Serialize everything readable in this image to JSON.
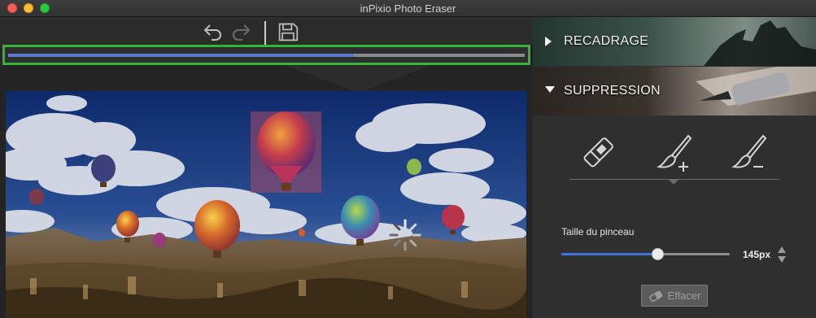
{
  "window": {
    "title": "inPixio Photo Eraser"
  },
  "toolbar": {
    "undo_icon": "undo-icon",
    "redo_icon": "redo-icon",
    "save_icon": "save-icon"
  },
  "progress": {
    "fraction": 0.67
  },
  "panel": {
    "sections": [
      {
        "label": "RECADRAGE",
        "expanded": false
      },
      {
        "label": "SUPPRESSION",
        "expanded": true
      }
    ],
    "tools": [
      {
        "name": "eraser-tool",
        "icon": "eraser-icon"
      },
      {
        "name": "brush-add-tool",
        "icon": "brush-plus-icon"
      },
      {
        "name": "brush-remove-tool",
        "icon": "brush-minus-icon"
      }
    ],
    "brush": {
      "label": "Taille du pinceau",
      "value_text": "145px",
      "slider_fraction": 0.57
    },
    "clear_button": {
      "label": "Effacer",
      "enabled": false
    }
  },
  "colors": {
    "selection_outline": "#35b535",
    "progress_fill": "#5b78c8",
    "slider_fill": "#3f74e0"
  }
}
